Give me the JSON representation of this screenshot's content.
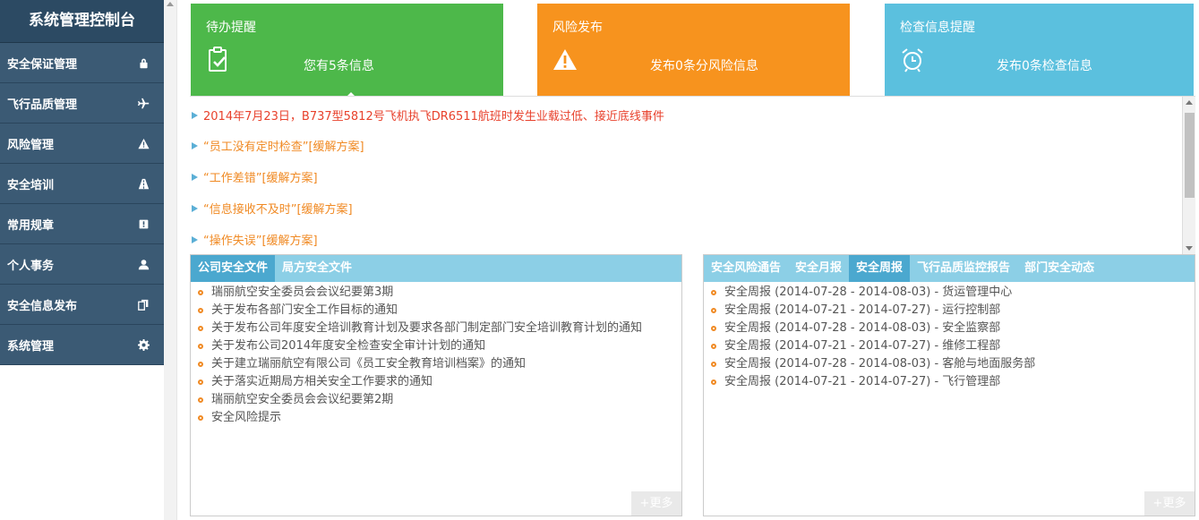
{
  "sidebar": {
    "title": "系统管理控制台",
    "items": [
      {
        "label": "安全保证管理",
        "icon": "lock-icon"
      },
      {
        "label": "飞行品质管理",
        "icon": "airplane-icon"
      },
      {
        "label": "风险管理",
        "icon": "warning-icon"
      },
      {
        "label": "安全培训",
        "icon": "road-icon"
      },
      {
        "label": "常用规章",
        "icon": "book-icon"
      },
      {
        "label": "个人事务",
        "icon": "user-icon"
      },
      {
        "label": "安全信息发布",
        "icon": "copy-icon"
      },
      {
        "label": "系统管理",
        "icon": "gear-icon"
      }
    ]
  },
  "cards": {
    "todo": {
      "title": "待办提醒",
      "text": "您有5条信息",
      "color": "#4db84a",
      "icon": "clipboard-check-icon"
    },
    "risk": {
      "title": "风险发布",
      "text": "发布0条分风险信息",
      "color": "#f7931e",
      "icon": "warning-icon"
    },
    "check": {
      "title": "检查信息提醒",
      "text": "发布0条检查信息",
      "color": "#5bc0de",
      "icon": "alarm-clock-icon"
    }
  },
  "notices": [
    {
      "text": "2014年7月23日，B737型5812号飞机执飞DR6511航班时发生业载过低、接近底线事件",
      "color": "red"
    },
    {
      "text": "“员工没有定时检查”[缓解方案]",
      "color": "orange"
    },
    {
      "text": "“工作差错”[缓解方案]",
      "color": "orange"
    },
    {
      "text": "“信息接收不及时”[缓解方案]",
      "color": "orange"
    },
    {
      "text": "“操作失误”[缓解方案]",
      "color": "orange"
    }
  ],
  "left_panel": {
    "tabs": [
      "公司安全文件",
      "局方安全文件"
    ],
    "active_tab": 0,
    "items": [
      "瑞丽航空安全委员会会议纪要第3期",
      "关于发布各部门安全工作目标的通知",
      "关于发布公司年度安全培训教育计划及要求各部门制定部门安全培训教育计划的通知",
      "关于发布公司2014年度安全检查安全审计计划的通知",
      "关于建立瑞丽航空有限公司《员工安全教育培训档案》的通知",
      "关于落实近期局方相关安全工作要求的通知",
      "瑞丽航空安全委员会会议纪要第2期",
      "安全风险提示"
    ],
    "more_label": "+更多"
  },
  "right_panel": {
    "tabs": [
      "安全风险通告",
      "安全月报",
      "安全周报",
      "飞行品质监控报告",
      "部门安全动态"
    ],
    "active_tab": 2,
    "items": [
      "安全周报 (2014-07-28 - 2014-08-03) - 货运管理中心",
      "安全周报 (2014-07-21 - 2014-07-27) - 运行控制部",
      "安全周报 (2014-07-28 - 2014-08-03) - 安全监察部",
      "安全周报 (2014-07-21 - 2014-07-27) - 维修工程部",
      "安全周报 (2014-07-28 - 2014-08-03) - 客舱与地面服务部",
      "安全周报 (2014-07-21 - 2014-07-27) - 飞行管理部"
    ],
    "more_label": "+更多"
  }
}
